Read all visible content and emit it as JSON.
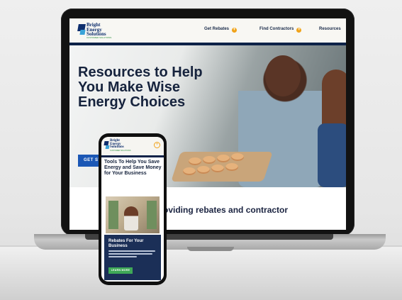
{
  "laptop_site": {
    "logo_text": "Bright\nEnergy\nSolutions",
    "logo_tagline": "CUSTOMER SOLUTIONS",
    "nav": [
      {
        "label": "Get Rebates"
      },
      {
        "label": "Find Contractors"
      },
      {
        "label": "Resources"
      }
    ],
    "nav_plus": "+",
    "hero_title": "Resources to Help You Make Wise Energy Choices",
    "cta_label": "GET ST",
    "subline": "oviding rebates and contractor"
  },
  "phone_site": {
    "logo_text": "Bright\nEnergy\nSolutions",
    "logo_tagline": "CUSTOMER SOLUTIONS",
    "menu_icon": "+",
    "hero_title": "Tools To Help You Save Energy and Save Money for Your Business",
    "card_title": "Rebates For Your Business",
    "card_button": "LEARN MORE"
  },
  "colors": {
    "navy": "#0d2248",
    "accent_orange": "#f0a31a",
    "cta_blue": "#1b57b5",
    "green": "#3fa857"
  }
}
